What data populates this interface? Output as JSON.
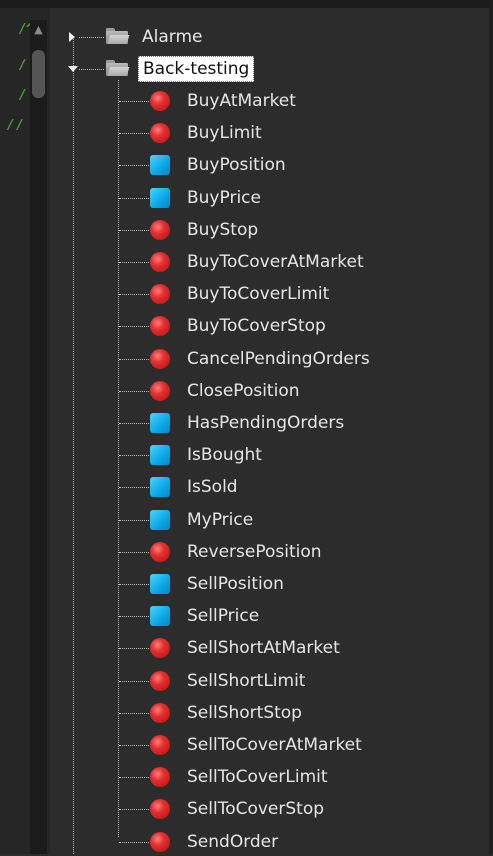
{
  "tree": {
    "folders": [
      {
        "label": "Alarme",
        "expanded": false,
        "icon": "folder-icon"
      },
      {
        "label": "Back-testing",
        "expanded": true,
        "selected": true,
        "icon": "folder-icon"
      }
    ],
    "items": [
      {
        "label": "BuyAtMarket",
        "icon": "red-circle-icon"
      },
      {
        "label": "BuyLimit",
        "icon": "red-circle-icon"
      },
      {
        "label": "BuyPosition",
        "icon": "blue-square-icon"
      },
      {
        "label": "BuyPrice",
        "icon": "blue-square-icon"
      },
      {
        "label": "BuyStop",
        "icon": "red-circle-icon"
      },
      {
        "label": "BuyToCoverAtMarket",
        "icon": "red-circle-icon"
      },
      {
        "label": "BuyToCoverLimit",
        "icon": "red-circle-icon"
      },
      {
        "label": "BuyToCoverStop",
        "icon": "red-circle-icon"
      },
      {
        "label": "CancelPendingOrders",
        "icon": "red-circle-icon"
      },
      {
        "label": "ClosePosition",
        "icon": "red-circle-icon"
      },
      {
        "label": "HasPendingOrders",
        "icon": "blue-square-icon"
      },
      {
        "label": "IsBought",
        "icon": "blue-square-icon"
      },
      {
        "label": "IsSold",
        "icon": "blue-square-icon"
      },
      {
        "label": "MyPrice",
        "icon": "blue-square-icon"
      },
      {
        "label": "ReversePosition",
        "icon": "red-circle-icon"
      },
      {
        "label": "SellPosition",
        "icon": "blue-square-icon"
      },
      {
        "label": "SellPrice",
        "icon": "blue-square-icon"
      },
      {
        "label": "SellShortAtMarket",
        "icon": "red-circle-icon"
      },
      {
        "label": "SellShortLimit",
        "icon": "red-circle-icon"
      },
      {
        "label": "SellShortStop",
        "icon": "red-circle-icon"
      },
      {
        "label": "SellToCoverAtMarket",
        "icon": "red-circle-icon"
      },
      {
        "label": "SellToCoverLimit",
        "icon": "red-circle-icon"
      },
      {
        "label": "SellToCoverStop",
        "icon": "red-circle-icon"
      },
      {
        "label": "SendOrder",
        "icon": "red-circle-icon"
      }
    ]
  },
  "colors": {
    "background": "#2c2c2c",
    "text": "#e6e6e6",
    "function_icon": "#e53030",
    "variable_icon": "#0aa6e6",
    "selection_bg": "#ffffff"
  }
}
